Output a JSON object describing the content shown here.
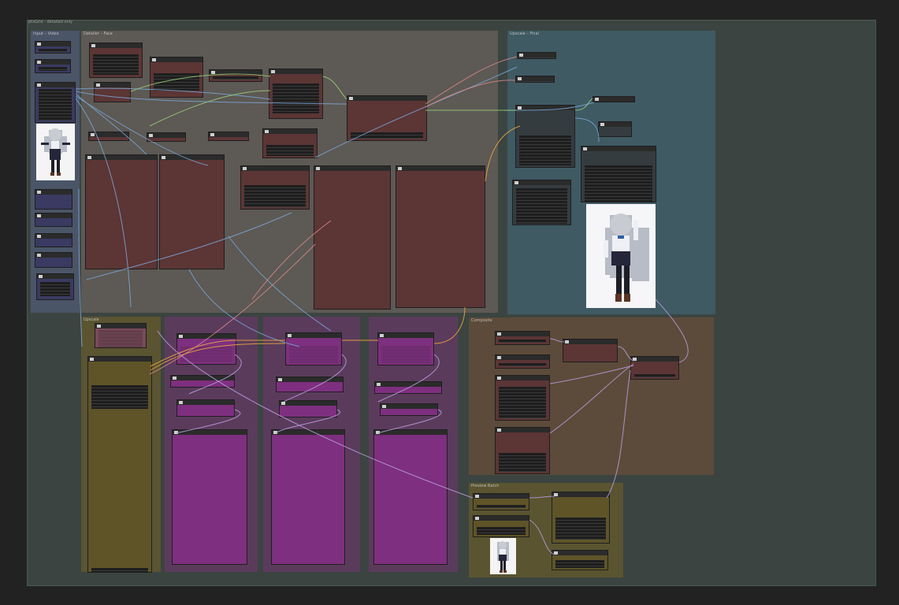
{
  "window": {
    "title": "ptxGrid - detailed only"
  },
  "groups": {
    "input": "Input – Video",
    "face": "Detailer – Face",
    "upscale": "Upscale – Final",
    "g4": "Upscale",
    "g5": "",
    "g6": "",
    "g7": "",
    "g8": "Composite",
    "g9": "Preview Batch"
  },
  "colors": {
    "canvas": "#3b4440",
    "group_gray": "#5d5954",
    "group_blue": "#3f5a63",
    "group_olive": "#5a5430",
    "group_mauve": "#5b3b5c",
    "group_brown": "#5c4b3a",
    "node_red": "#5c3535",
    "node_blue": "#3a3a62",
    "node_magenta": "#7e2f7f",
    "link_blue": "#7aa7d8",
    "link_green": "#9ad17a",
    "link_orange": "#e2a040",
    "link_pink": "#d88a8a",
    "link_violet": "#b59ad8"
  },
  "images": {
    "reference": "anime-girl-thumbnail",
    "output_large": "anime-girl-fullbody",
    "output_small": "anime-girl-small"
  }
}
